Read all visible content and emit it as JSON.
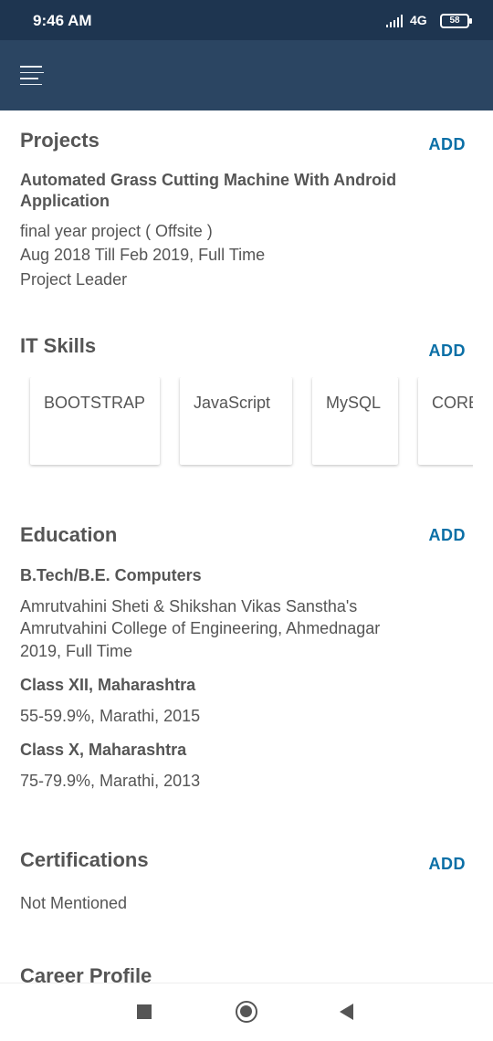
{
  "status_bar": {
    "time": "9:46 AM",
    "network": "4G",
    "battery": "58"
  },
  "sections": {
    "projects": {
      "title": "Projects",
      "add_label": "ADD",
      "item": {
        "name_line1": "Automated Grass Cutting Machine With Android",
        "name_line2": "Application",
        "type": "final year project ( Offsite )",
        "duration": "Aug 2018 Till Feb 2019, Full Time",
        "role": "Project Leader"
      }
    },
    "it_skills": {
      "title": "IT Skills",
      "add_label": "ADD",
      "skills": [
        "BOOTSTRAP",
        "JavaScript",
        "MySQL",
        "CORE"
      ]
    },
    "education": {
      "title": "Education",
      "add_label": "ADD",
      "entries": [
        {
          "degree": "B.Tech/B.E. Computers",
          "institute_line1": "Amrutvahini Sheti & Shikshan Vikas Sanstha's",
          "institute_line2": "Amrutvahini College of Engineering, Ahmednagar",
          "year": "2019, Full Time"
        },
        {
          "degree": "Class XII, Maharashtra",
          "details": "55-59.9%, Marathi, 2015"
        },
        {
          "degree": "Class X, Maharashtra",
          "details": "75-79.9%, Marathi, 2013"
        }
      ]
    },
    "certifications": {
      "title": "Certifications",
      "add_label": "ADD",
      "value": "Not Mentioned"
    },
    "career_profile": {
      "title": "Career Profile"
    }
  },
  "icons": {
    "menu": "hamburger-menu-icon",
    "signal": "signal-icon",
    "battery": "battery-icon",
    "recents": "recents-icon",
    "home": "home-icon",
    "back": "back-icon"
  }
}
